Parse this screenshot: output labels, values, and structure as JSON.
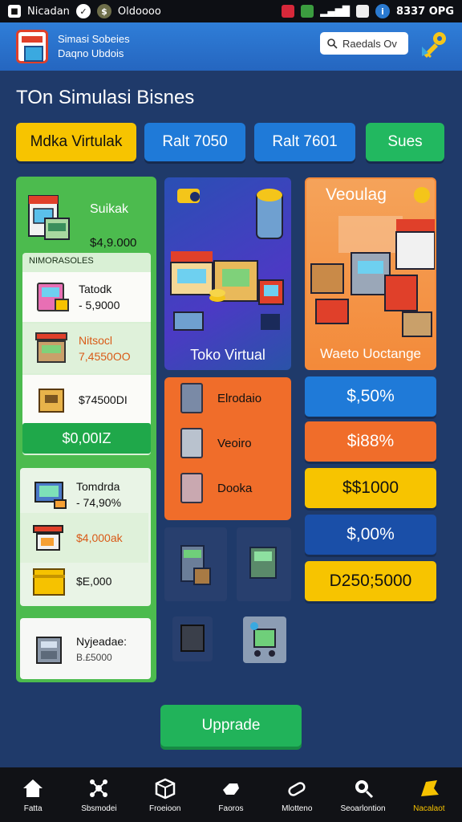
{
  "status_bar": {
    "app_name": "Nicadan",
    "carrier": "Oldoooo",
    "battery_text": "8337 OPG"
  },
  "app_bar": {
    "title": "Simasi Sobeies",
    "subtitle": "Daqno Ubdois",
    "search_label": "Raedals Ov",
    "colors": {
      "bar": "#2f7ed8",
      "logo_red": "#e0402a"
    }
  },
  "section_title": "TOn Simulasi Bisnes",
  "tabs": [
    {
      "label": "Mdka Virtulak",
      "color": "#f7c400",
      "text_color": "#111"
    },
    {
      "label": "Ralt 7050",
      "color": "#1f7ad8",
      "text_color": "#fff"
    },
    {
      "label": "Ralt 7601",
      "color": "#1f7ad8",
      "text_color": "#fff"
    },
    {
      "label": "Sues",
      "color": "#22b860",
      "text_color": "#fff"
    }
  ],
  "left_column": {
    "store_name": "Suikak",
    "store_price": "$4,9.000",
    "list_header": "NIMORASOLES",
    "rows": [
      {
        "name": "Tatodk",
        "value": "- 5,9000",
        "icon": "arcade-shop-icon"
      },
      {
        "name": "Nitsocl",
        "value": "7,4550OO",
        "icon": "market-stall-icon"
      },
      {
        "name": "$74500DI",
        "value": "",
        "icon": "crate-icon"
      }
    ],
    "total": "$0,00IZ",
    "card2_rows": [
      {
        "name": "Tomdrda",
        "value": "- 74,90%",
        "icon": "computer-icon"
      },
      {
        "name": "$4,000ak",
        "value": "",
        "icon": "shop-icon"
      },
      {
        "name": "$E,000",
        "value": "",
        "icon": "box-icon"
      }
    ],
    "card3": {
      "name": "Nyjeadae:",
      "value": "B.£5000",
      "icon": "register-icon"
    }
  },
  "middle_column": {
    "feature_label": "Toko Virtual",
    "items": [
      {
        "label": "Elrodaio",
        "icon": "fridge-icon"
      },
      {
        "label": "Veoiro",
        "icon": "cabinet-icon"
      },
      {
        "label": "Dooka",
        "icon": "locker-icon"
      }
    ]
  },
  "right_column": {
    "title": "Veoulag",
    "label": "Waeto Uoctange",
    "stats": [
      {
        "value": "$,50%",
        "color": "#1f7ad8",
        "text_color": "#fff"
      },
      {
        "value": "$i88%",
        "color": "#f06d2a",
        "text_color": "#fff"
      },
      {
        "value": "$$1000",
        "color": "#f7c400",
        "text_color": "#111"
      },
      {
        "value": "$,00%",
        "color": "#1a4fa8",
        "text_color": "#fff"
      },
      {
        "value": "D250;5000",
        "color": "#f7c400",
        "text_color": "#111"
      }
    ]
  },
  "upgrade_button": "Upprade",
  "bottom_nav": [
    {
      "label": "Fatta",
      "icon": "home-icon",
      "active": false
    },
    {
      "label": "Sbsmodei",
      "icon": "network-icon",
      "active": false
    },
    {
      "label": "Froeioon",
      "icon": "package-icon",
      "active": false
    },
    {
      "label": "Faoros",
      "icon": "hand-icon",
      "active": false
    },
    {
      "label": "Mlotteno",
      "icon": "tools-icon",
      "active": false
    },
    {
      "label": "Seoarlontion",
      "icon": "search-icon",
      "active": false
    },
    {
      "label": "Nacalaot",
      "icon": "trophy-icon",
      "active": true
    }
  ]
}
